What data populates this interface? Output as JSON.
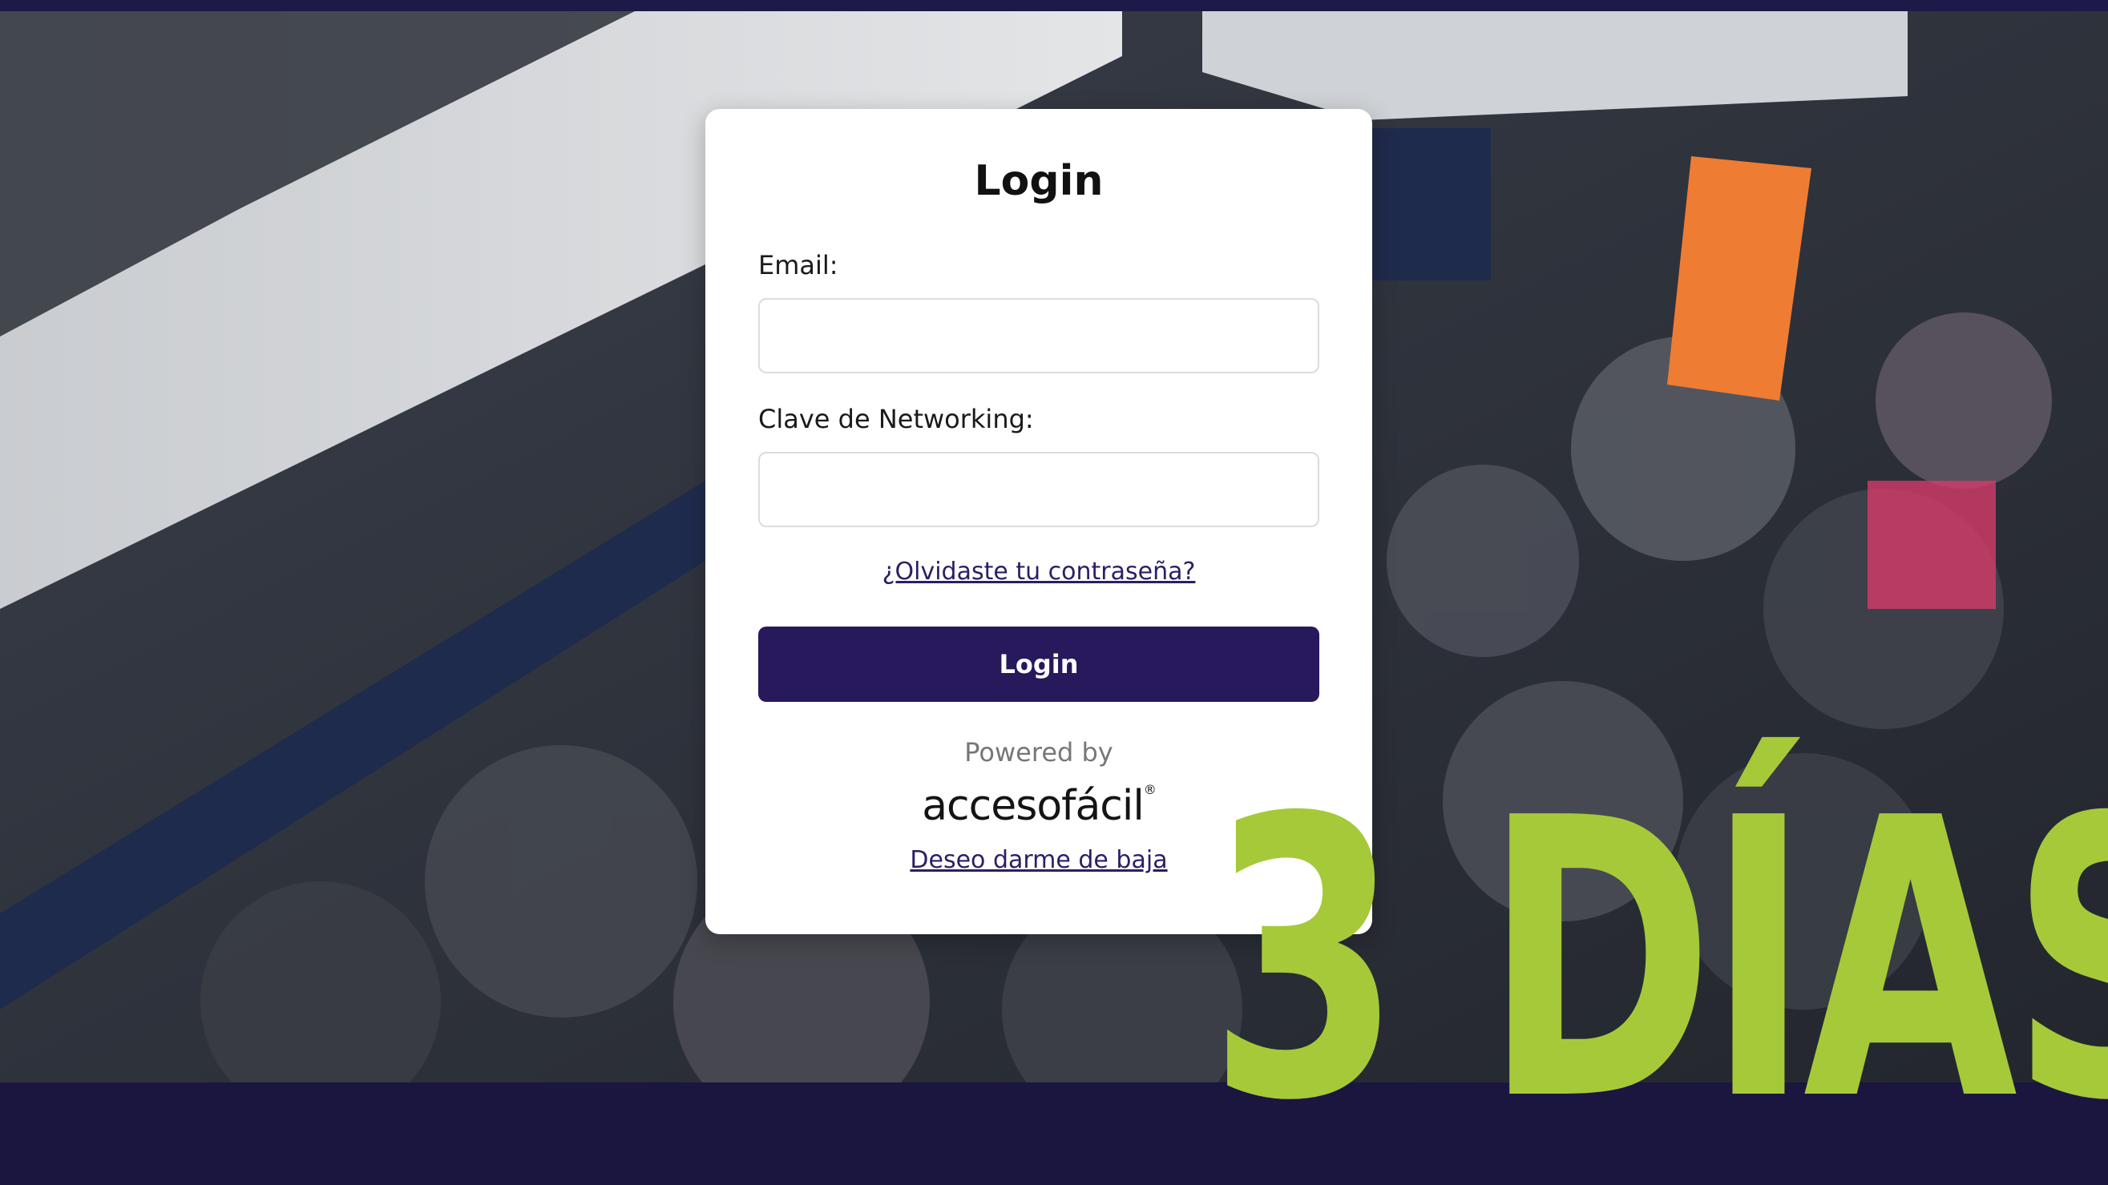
{
  "login_card": {
    "title": "Login",
    "email_label": "Email:",
    "email_value": "",
    "password_label": "Clave de Networking:",
    "password_value": "",
    "forgot_link": "¿Olvidaste tu contraseña?",
    "login_button": "Login",
    "powered_by": "Powered by",
    "brand_name": "accesofácil",
    "unsubscribe_link": "Deseo darme de baja"
  },
  "banner": {
    "days_text": "3 DÍAS"
  },
  "colors": {
    "button": "#27195c",
    "link": "#2a1f66",
    "banner_green": "#a6c93a",
    "card": "#ffffff"
  }
}
